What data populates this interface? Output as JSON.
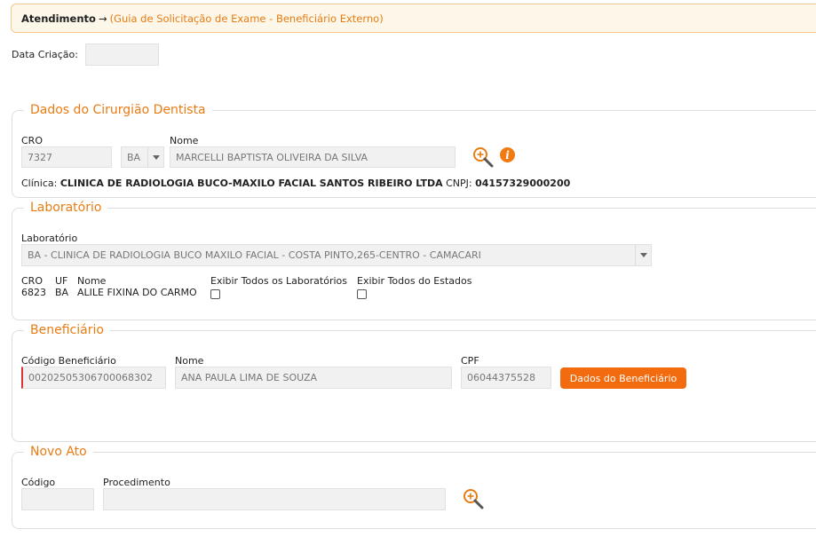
{
  "breadcrumb": {
    "title": "Atendimento",
    "arrow": "→",
    "subtitle": "(Guia de Solicitação de Exame - Beneficiário Externo)"
  },
  "header": {
    "data_criacao_label": "Data Criação:",
    "data_criacao_value": ""
  },
  "dentista": {
    "legend": "Dados do Cirurgião Dentista",
    "cro_label": "CRO",
    "cro_value": "7327",
    "uf_value": "BA",
    "nome_label": "Nome",
    "nome_value": "MARCELLI BAPTISTA OLIVEIRA DA SILVA",
    "search_icon": "search-icon",
    "info_icon": "info-icon",
    "info_glyph": "i",
    "clinica_label": "Clínica:",
    "clinica_value": "CLINICA DE RADIOLOGIA BUCO-MAXILO FACIAL SANTOS RIBEIRO LTDA",
    "cnpj_label": "CNPJ:",
    "cnpj_value": "04157329000200"
  },
  "laboratorio": {
    "legend": "Laboratório",
    "select_label": "Laboratório",
    "select_value": "BA - CLINICA DE RADIOLOGIA BUCO MAXILO FACIAL - COSTA PINTO,265-CENTRO - CAMACARI",
    "cro_header": "CRO",
    "uf_header": "UF",
    "nome_header": "Nome",
    "cro_value": "6823",
    "uf_value": "BA",
    "nome_value": "ALILE FIXINA DO CARMO",
    "exibir_todos_labs_label": "Exibir Todos os Laboratórios",
    "exibir_todos_estados_label": "Exibir Todos do Estados",
    "exibir_todos_labs_checked": false,
    "exibir_todos_estados_checked": false
  },
  "beneficiario": {
    "legend": "Beneficiário",
    "codigo_label": "Código Beneficiário",
    "codigo_value": "00202505306700068302",
    "nome_label": "Nome",
    "nome_value": "ANA PAULA LIMA DE SOUZA",
    "cpf_label": "CPF",
    "cpf_value": "06044375528",
    "dados_button": "Dados do Beneficiário"
  },
  "novo_ato": {
    "legend": "Novo Ato",
    "codigo_label": "Código",
    "codigo_value": "",
    "procedimento_label": "Procedimento",
    "procedimento_value": "",
    "search_icon": "search-icon"
  },
  "colors": {
    "accent": "#e87c13",
    "button": "#f26b0f",
    "input_bg": "#f1f1f1",
    "required": "#dd3333"
  }
}
